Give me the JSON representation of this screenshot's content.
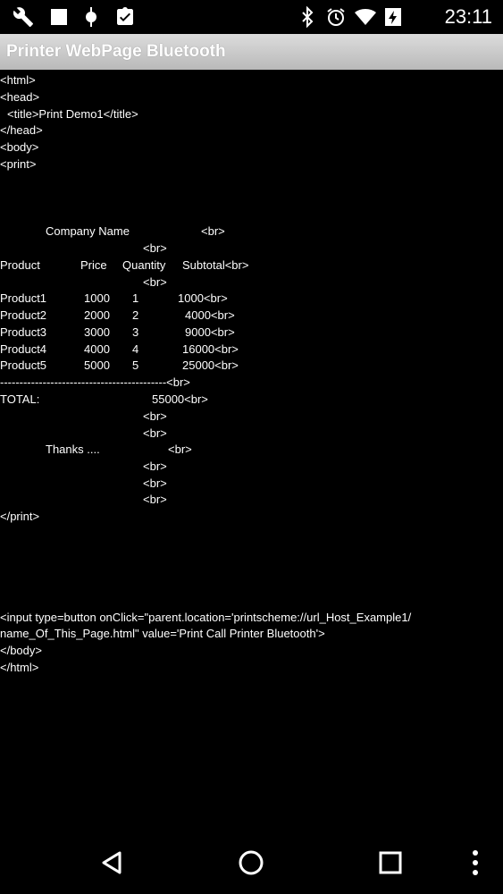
{
  "status_bar": {
    "time": "23:11",
    "left_icons": [
      "wrench-icon",
      "square-icon",
      "android-debug-icon",
      "clipboard-check-icon"
    ],
    "right_icons": [
      "bluetooth-icon",
      "alarm-icon",
      "wifi-icon",
      "battery-icon"
    ]
  },
  "app": {
    "title": "Printer WebPage Bluetooth"
  },
  "source": {
    "html_open": "<html>",
    "head_open": "<head>",
    "title_line": "<title>Print Demo1</title>",
    "head_close": "</head>",
    "body_open": "<body>",
    "print_open": "<print>",
    "company": "Company Name",
    "br": "<br>",
    "hdr_product": "Product",
    "hdr_price": "Price",
    "hdr_quantity": "Quantity",
    "hdr_subtotal": "Subtotal<br>",
    "rows": [
      {
        "product": "Product1",
        "price": "1000",
        "qty": "1",
        "subtotal": "1000<br>"
      },
      {
        "product": "Product2",
        "price": "2000",
        "qty": "2",
        "subtotal": "4000<br>"
      },
      {
        "product": "Product3",
        "price": "3000",
        "qty": "3",
        "subtotal": "9000<br>"
      },
      {
        "product": "Product4",
        "price": "4000",
        "qty": "4",
        "subtotal": "16000<br>"
      },
      {
        "product": "Product5",
        "price": "5000",
        "qty": "5",
        "subtotal": "25000<br>"
      }
    ],
    "divider": "-------------------------------------------<br>",
    "total_label": "TOTAL:",
    "total_value": "55000<br>",
    "thanks": "Thanks ....",
    "print_close": "</print>",
    "input_line1": "<input type=button onClick=\"parent.location='printscheme://url_Host_Example1/",
    "input_line2": "name_Of_This_Page.html\" value='Print Call Printer Bluetooth'>",
    "body_close": "</body>",
    "html_close": "</html>"
  },
  "nav": {
    "buttons": [
      "back-icon",
      "home-icon",
      "recents-icon",
      "overflow-menu-icon"
    ]
  }
}
